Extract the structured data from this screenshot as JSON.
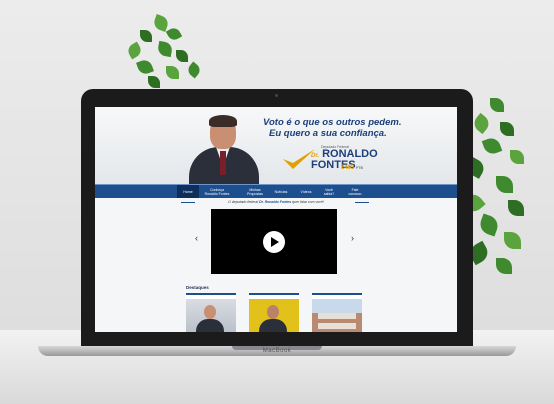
{
  "device": {
    "brand": "MacBook"
  },
  "site": {
    "slogan_line1": "Voto é o que os outros pedem.",
    "slogan_line2": "Eu quero a sua confiança.",
    "logo": {
      "small_text": "Deputado Federal",
      "dr": "Dr.",
      "first_name": "RONALDO",
      "last_name": "FONTES",
      "number": "1463",
      "party": "PTB"
    },
    "nav": [
      {
        "label": "Home",
        "active": true
      },
      {
        "label": "Conheça Ronaldo Fontes"
      },
      {
        "label": "Minhas Propostas"
      },
      {
        "label": "Notícias"
      },
      {
        "label": "Vídeos"
      },
      {
        "label": "Você sabia?"
      },
      {
        "label": "Fale conosco"
      }
    ],
    "intro_prefix": "O deputado federal",
    "intro_name": "Dr. Ronaldo Fontes",
    "intro_suffix": "quer falar com você!",
    "carousel": {
      "prev": "‹",
      "next": "›"
    },
    "highlights_title": "Destaques"
  },
  "colors": {
    "primary": "#1d4f8f",
    "accent": "#e0a000",
    "nav_active": "#0e2f5c"
  }
}
